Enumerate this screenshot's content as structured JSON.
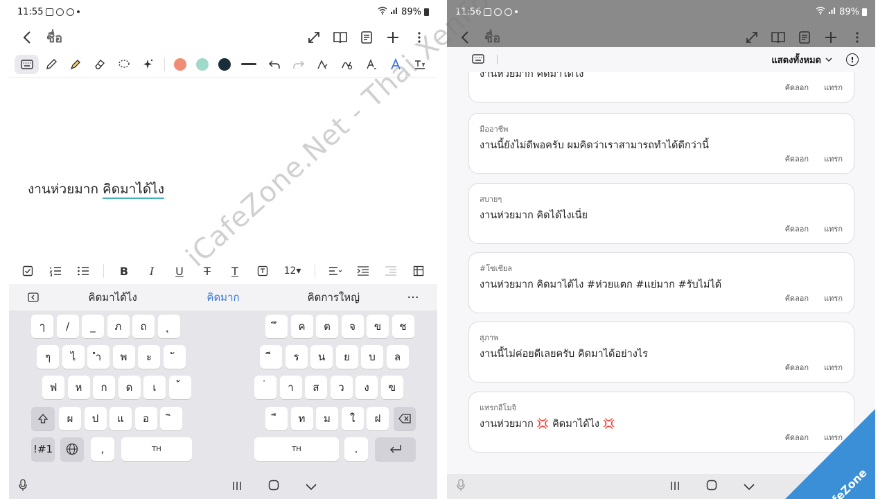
{
  "left": {
    "status": {
      "time": "11:55",
      "battery": "89%"
    },
    "title": "ชื่อ",
    "note_text_plain": "งานห่วยมาก",
    "note_text_underlined": "คิดมาได้ไง",
    "font_size": "12",
    "suggestions": [
      "คิดมาได้ไง",
      "คิดมาก",
      "คิดการใหญ่"
    ],
    "more": "···",
    "pen_colors": [
      "#f28b74",
      "#9fd9c9",
      "#1a2d3a"
    ],
    "keyboard": {
      "row1_left": [
        "ๅ",
        "/",
        "_",
        "ภ",
        "ถ",
        "ุ"
      ],
      "row1_right": [
        "ึ",
        "ค",
        "ต",
        "จ",
        "ข",
        "ช"
      ],
      "row2_left": [
        "ๆ",
        "ไ",
        "ำ",
        "พ",
        "ะ",
        "ั"
      ],
      "row2_right": [
        "ี",
        "ร",
        "น",
        "ย",
        "บ",
        "ล"
      ],
      "row3_left": [
        "ฟ",
        "ห",
        "ก",
        "ด",
        "เ",
        "้"
      ],
      "row3_right": [
        "่",
        "า",
        "ส",
        "ว",
        "ง",
        "ฃ"
      ],
      "row4_left": [
        "ผ",
        "ป",
        "แ",
        "อ",
        "ิ"
      ],
      "row4_right": [
        "ื",
        "ท",
        "ม",
        "ใ",
        "ฝ"
      ],
      "sym": "!#1",
      "comma": ",",
      "lang": "TH",
      "period": "."
    }
  },
  "right": {
    "status": {
      "time": "11:56",
      "battery": "89%"
    },
    "title": "ชื่อ",
    "show_all": "แสดงทั้งหมด",
    "cards": [
      {
        "category": "",
        "text": "งานห่วยมาก คิดมาได้ไง",
        "copy": "คัดลอก",
        "insert": "แทรก"
      },
      {
        "category": "มืออาชีพ",
        "text": "งานนี้ยังไม่ดีพอครับ ผมคิดว่าเราสามารถทำได้ดีกว่านี้",
        "copy": "คัดลอก",
        "insert": "แทรก"
      },
      {
        "category": "สบายๆ",
        "text": "งานห่วยมาก คิดได้ไงเนี่ย",
        "copy": "คัดลอก",
        "insert": "แทรก"
      },
      {
        "category": "#โซเชียล",
        "text": "งานห่วยมาก คิดมาได้ไง #ห่วยแตก #แย่มาก #รับไม่ได้",
        "copy": "คัดลอก",
        "insert": "แทรก"
      },
      {
        "category": "สุภาพ",
        "text": "งานนี้ไม่ค่อยดีเลยครับ คิดมาได้อย่างไร",
        "copy": "คัดลอก",
        "insert": "แทรก"
      },
      {
        "category": "แทรกอีโมจิ",
        "text_a": "งานห่วยมาก",
        "emoji": "💢",
        "text_b": "คิดมาได้ไง",
        "copy": "คัดลอก",
        "insert": "แทรก"
      }
    ]
  },
  "watermark": "iCafeZone.Net - Thai XenForo Community",
  "corner_logo": "iCafeZone",
  "colors": {
    "underline": "#46b0c3",
    "suggestion_highlight": "#3b76d6",
    "corner": "#3a8fd6"
  }
}
